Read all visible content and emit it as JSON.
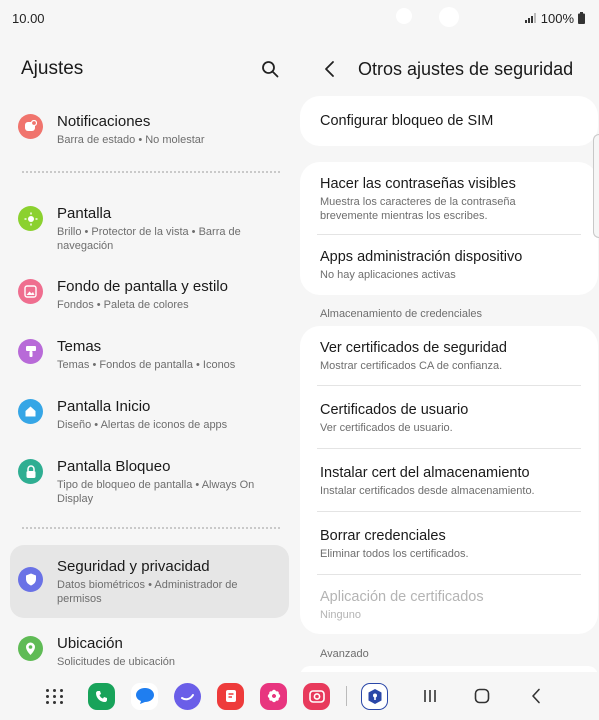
{
  "status": {
    "time": "10.00",
    "battery": "100%"
  },
  "left": {
    "title": "Ajustes",
    "items": [
      {
        "title": "Notificaciones",
        "sub": "Barra de estado  •  No molestar",
        "color": "#f0746d"
      },
      {
        "title": "Pantalla",
        "sub": "Brillo  •  Protector de la vista  •  Barra de navegación",
        "color": "#8bd12f"
      },
      {
        "title": "Fondo de pantalla y estilo",
        "sub": "Fondos  •  Paleta de colores",
        "color": "#ef6e8f"
      },
      {
        "title": "Temas",
        "sub": "Temas  •  Fondos de pantalla  •  Iconos",
        "color": "#b86ad8"
      },
      {
        "title": "Pantalla Inicio",
        "sub": "Diseño  •  Alertas de iconos de apps",
        "color": "#36a6e6"
      },
      {
        "title": "Pantalla Bloqueo",
        "sub": "Tipo de bloqueo de pantalla  •  Always On Display",
        "color": "#2fae92"
      },
      {
        "title": "Seguridad y privacidad",
        "sub": "Datos biométricos  •  Administrador de permisos",
        "color": "#6a72e6"
      },
      {
        "title": "Ubicación",
        "sub": "Solicitudes de ubicación",
        "color": "#5fbb55"
      }
    ]
  },
  "right": {
    "title": "Otros ajustes de seguridad",
    "sim": {
      "title": "Configurar bloqueo de SIM"
    },
    "visible": {
      "title": "Hacer las contraseñas visibles",
      "sub": "Muestra los caracteres de la contraseña brevemente mientras los escribes."
    },
    "apps_admin": {
      "title": "Apps administración dispositivo",
      "sub": "No hay aplicaciones activas"
    },
    "section_credentials": "Almacenamiento de credenciales",
    "certs": [
      {
        "title": "Ver certificados de seguridad",
        "sub": "Mostrar certificados CA de confianza."
      },
      {
        "title": "Certificados de usuario",
        "sub": "Ver certificados de usuario."
      },
      {
        "title": "Instalar cert del almacenamiento",
        "sub": "Instalar certificados desde almacenamiento."
      },
      {
        "title": "Borrar credenciales",
        "sub": "Eliminar todos los certificados."
      },
      {
        "title": "Aplicación de certificados",
        "sub": "Ninguno"
      }
    ],
    "section_advanced": "Avanzado"
  },
  "taskbar": {
    "apps": [
      {
        "name": "phone",
        "color": "#18a35a"
      },
      {
        "name": "messages",
        "color": "#1f7ef0"
      },
      {
        "name": "internet",
        "color": "#6a5ee8"
      },
      {
        "name": "notes",
        "color": "#ee3b3b"
      },
      {
        "name": "gallery",
        "color": "#e8357f"
      },
      {
        "name": "camera",
        "color": "#e83a5c"
      },
      {
        "name": "secure-folder",
        "color": "#2a47a8"
      }
    ]
  },
  "colors": {
    "accent": "#2f78e6",
    "active_bg": "#e6e6e6"
  }
}
